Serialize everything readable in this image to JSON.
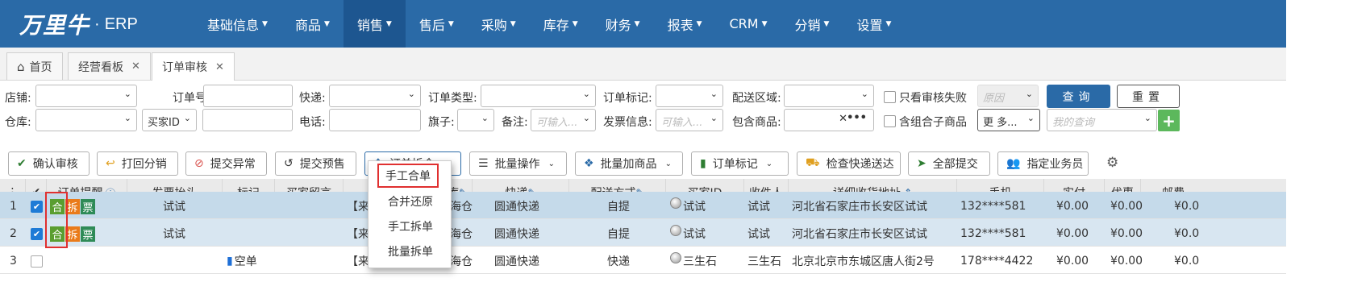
{
  "app": {
    "brand": "万里牛",
    "dot": "·",
    "product": "ERP"
  },
  "nav": [
    {
      "label": "基础信息",
      "active": false
    },
    {
      "label": "商品",
      "active": false
    },
    {
      "label": "销售",
      "active": true
    },
    {
      "label": "售后",
      "active": false
    },
    {
      "label": "采购",
      "active": false
    },
    {
      "label": "库存",
      "active": false
    },
    {
      "label": "财务",
      "active": false
    },
    {
      "label": "报表",
      "active": false
    },
    {
      "label": "CRM",
      "active": false
    },
    {
      "label": "分销",
      "active": false
    },
    {
      "label": "设置",
      "active": false
    }
  ],
  "tabs": [
    {
      "label": "首页"
    },
    {
      "label": "经营看板"
    },
    {
      "label": "订单审核"
    }
  ],
  "filters": {
    "shop": "店铺:",
    "order_no": "订单号:",
    "express": "快递:",
    "order_type": "订单类型:",
    "order_mark": "订单标记:",
    "region": "配送区域:",
    "only_failed": "只看审核失败",
    "reason_placeholder": "原因",
    "query_btn": "查询",
    "reset_btn": "重置",
    "warehouse": "仓库:",
    "buyer_select": "买家ID",
    "phone": "电话:",
    "flag": "旗子:",
    "remark": "备注:",
    "remark_placeholder": "可输入...",
    "invoice": "发票信息:",
    "invoice_placeholder": "可输入...",
    "contains_goods": "包含商品:",
    "combo": "含组合子商品",
    "more": "更 多...",
    "my_query": "我的查询"
  },
  "toolbar": {
    "confirm": "确认审核",
    "return_pick": "打回分销",
    "submit_exception": "提交异常",
    "submit_presale": "提交预售",
    "split_merge": "订单拆合",
    "batch_ops": "批量操作",
    "batch_add_goods": "批量加商品",
    "order_mark": "订单标记",
    "check_express": "检查快递送达",
    "submit_all": "全部提交",
    "assign_sales": "指定业务员"
  },
  "menu": [
    "手工合单",
    "合并还原",
    "手工拆单",
    "批量拆单"
  ],
  "columns": {
    "reminder": "订单提醒",
    "invoice_head": "发票抬头",
    "mark": "标记",
    "buyer_msg": "买家留言",
    "warehouse": "库",
    "express": "快递",
    "delivery": "配送方式",
    "buyer_id": "买家ID",
    "receiver": "收件人",
    "address": "详细收货地址",
    "mobile": "手机",
    "paid": "实付",
    "discount": "优惠",
    "postage": "邮费"
  },
  "rows": [
    {
      "idx": "1",
      "checked": true,
      "tags": [
        "合",
        "拆",
        "票"
      ],
      "invoice": "试试",
      "mark": "",
      "msg": "【来",
      "wh": "海仓",
      "express": "圆通快递",
      "delivery": "自提",
      "buyer": "试试",
      "receiver": "试试",
      "address": "河北省石家庄市长安区试试",
      "mobile": "132****581",
      "paid": "¥0.00",
      "discount": "¥0.00",
      "postage": "¥0.0"
    },
    {
      "idx": "2",
      "checked": true,
      "tags": [
        "合",
        "拆",
        "票"
      ],
      "invoice": "试试",
      "mark": "",
      "msg": "【来",
      "wh": "海仓",
      "express": "圆通快递",
      "delivery": "自提",
      "buyer": "试试",
      "receiver": "试试",
      "address": "河北省石家庄市长安区试试",
      "mobile": "132****581",
      "paid": "¥0.00",
      "discount": "¥0.00",
      "postage": "¥0.0"
    },
    {
      "idx": "3",
      "checked": false,
      "tags": [],
      "invoice": "",
      "mark": "空单",
      "msg": "【来",
      "wh": "海仓",
      "express": "圆通快递",
      "delivery": "快递",
      "buyer": "三生石",
      "receiver": "三生石",
      "address": "北京北京市东城区唐人街2号",
      "mobile": "178****4422",
      "paid": "¥0.00",
      "discount": "¥0.00",
      "postage": "¥0.0"
    }
  ],
  "colors": {
    "primary": "#2a6aa7",
    "nav_active": "#1d5690",
    "selected_row": "#c5daea",
    "highlight": "#e03030"
  }
}
